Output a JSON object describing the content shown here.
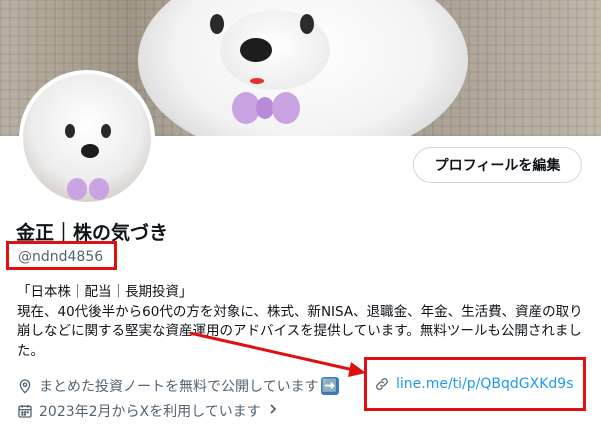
{
  "profile": {
    "display_name": "金正｜株の気づき",
    "handle": "@ndnd4856",
    "edit_button_label": "プロフィールを編集",
    "bio": "「日本株｜配当｜長期投資」\n現在、40代後半から60代の方を対象に、株式、新NISA、退職金、年金、生活費、資産の取り崩しなどに関する堅実な資産運用のアドバイスを提供しています。無料ツールも公開されました。",
    "location": "まとめた投資ノートを無料で公開しています",
    "location_emoji": "➡️",
    "link_text": "line.me/ti/p/QBqdGXKd9s",
    "joined": "2023年2月からXを利用しています"
  },
  "icons": {
    "location": "location-pin-icon",
    "link": "link-icon",
    "calendar": "calendar-icon",
    "chevron": "chevron-right-icon"
  },
  "colors": {
    "link": "#1d9bf0",
    "secondary_text": "#536471",
    "highlight": "#e01010"
  }
}
